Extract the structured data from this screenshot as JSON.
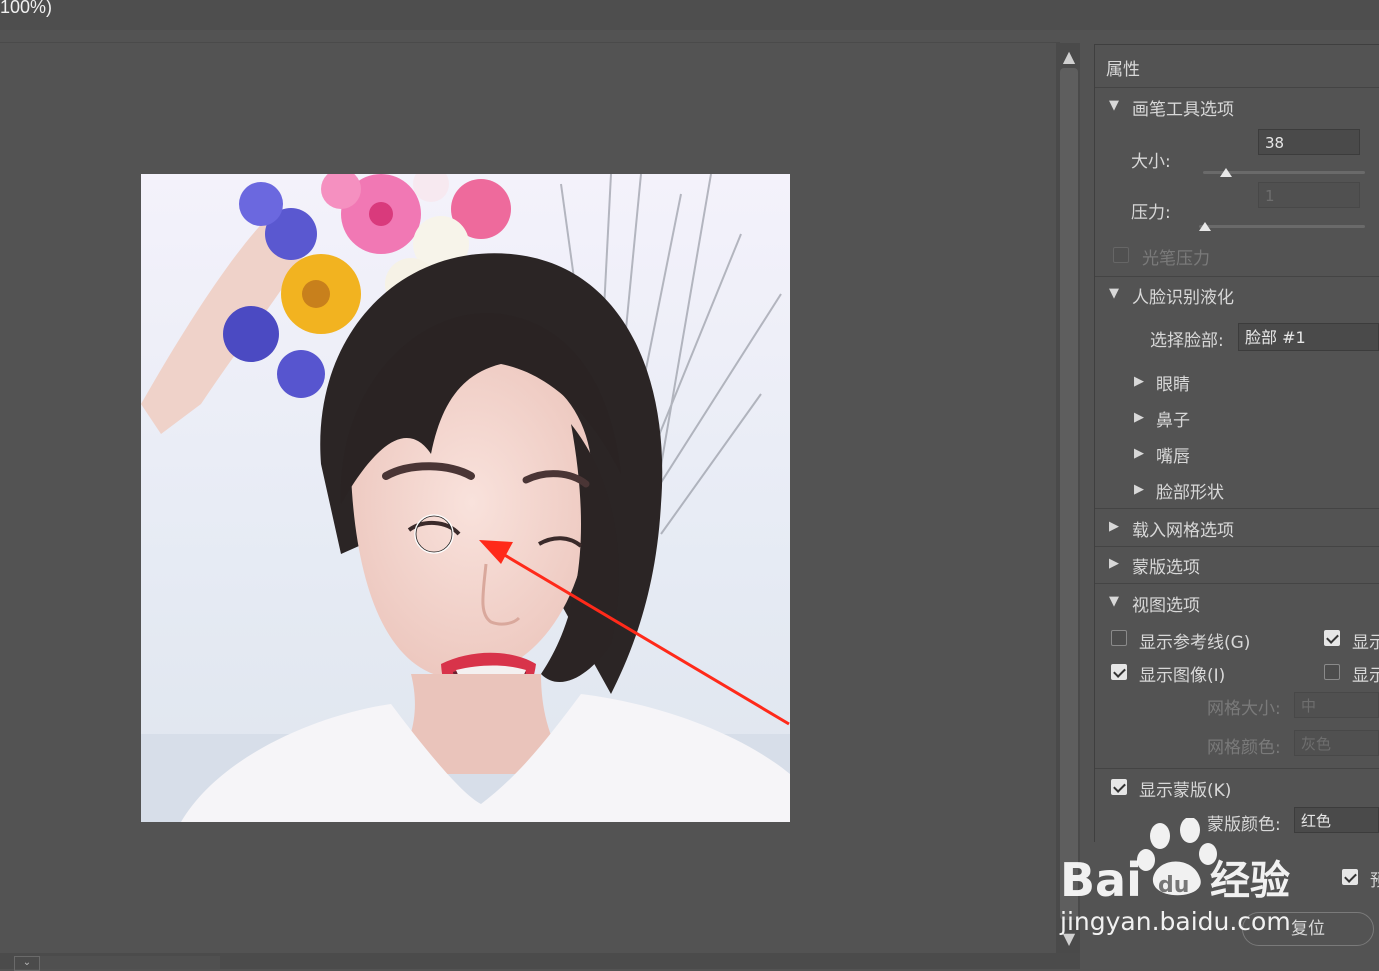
{
  "window": {
    "title_fragment": "100%)"
  },
  "properties": {
    "title": "属性",
    "brush_section": {
      "label": "画笔工具选项",
      "size_label": "大小:",
      "size_value": "38",
      "size_level": 0.15,
      "pressure_label": "压力:",
      "pressure_value": "1",
      "pressure_level": 0.01,
      "stylus_label": "光笔压力"
    },
    "face_section": {
      "label": "人脸识别液化",
      "select_face_label": "选择脸部:",
      "select_face_value": "脸部 #1",
      "items": [
        "眼睛",
        "鼻子",
        "嘴唇",
        "脸部形状"
      ]
    },
    "load_mesh_label": "载入网格选项",
    "mask_options_label": "蒙版选项",
    "view_section": {
      "label": "视图选项",
      "show_guides": "显示参考线(G)",
      "show_image": "显示图像(I)",
      "show_right_1": "显示",
      "show_right_2": "显示",
      "mesh_size_label": "网格大小:",
      "mesh_size_value": "中",
      "mesh_color_label": "网格颜色:",
      "mesh_color_value": "灰色",
      "show_mask": "显示蒙版(K)",
      "mask_color_label": "蒙版颜色:",
      "mask_color_value": "红色"
    },
    "preview_label": "预",
    "reset_label": "复位"
  },
  "watermark": {
    "brand": "Bai",
    "du": "du",
    "jingyan": "经验",
    "url": "jingyan.baidu.com"
  },
  "colors": {
    "panel": "#535353",
    "arrow": "#ff2a1a",
    "brand_blue": "#ffffff"
  }
}
